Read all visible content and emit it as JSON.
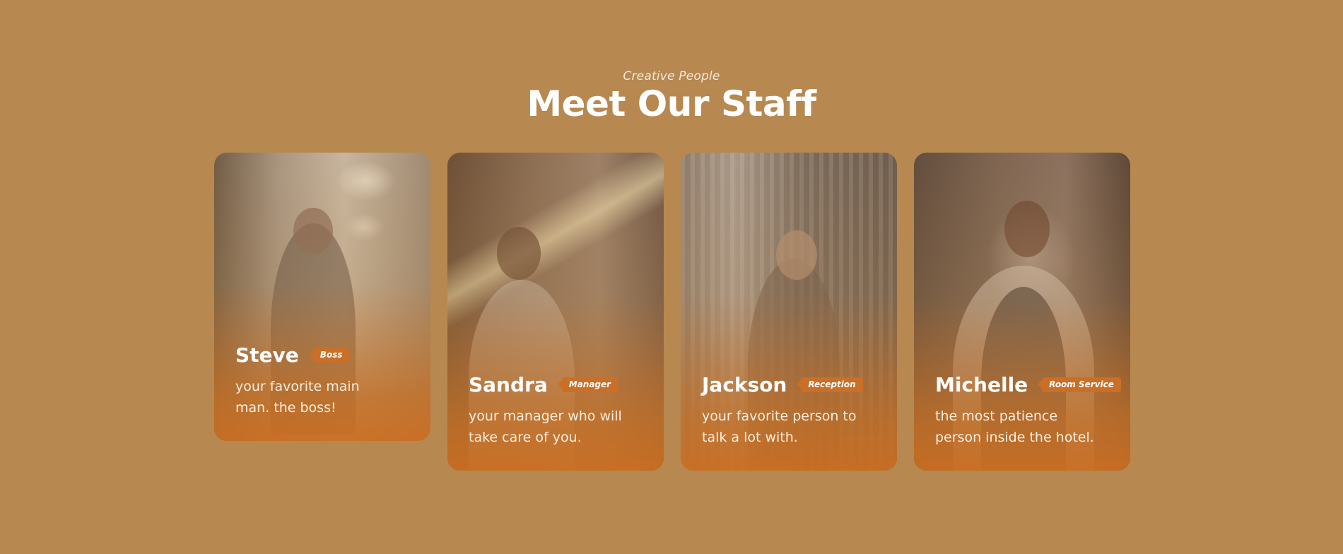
{
  "section": {
    "eyebrow": "Creative People",
    "title": "Meet Our Staff"
  },
  "staff": [
    {
      "name": "Steve",
      "role": "Boss",
      "description": "your favorite main man. the boss!",
      "photo_icon": "photo-steve"
    },
    {
      "name": "Sandra",
      "role": "Manager",
      "description": "your manager who will take care of you.",
      "photo_icon": "photo-sandra"
    },
    {
      "name": "Jackson",
      "role": "Reception",
      "description": "your favorite person to talk a lot with.",
      "photo_icon": "photo-jackson"
    },
    {
      "name": "Michelle",
      "role": "Room Service",
      "description": "the most patience person inside the hotel.",
      "photo_icon": "photo-michelle"
    }
  ],
  "colors": {
    "background": "#b78850",
    "badge": "#c96f28",
    "text": "#ffffff"
  }
}
